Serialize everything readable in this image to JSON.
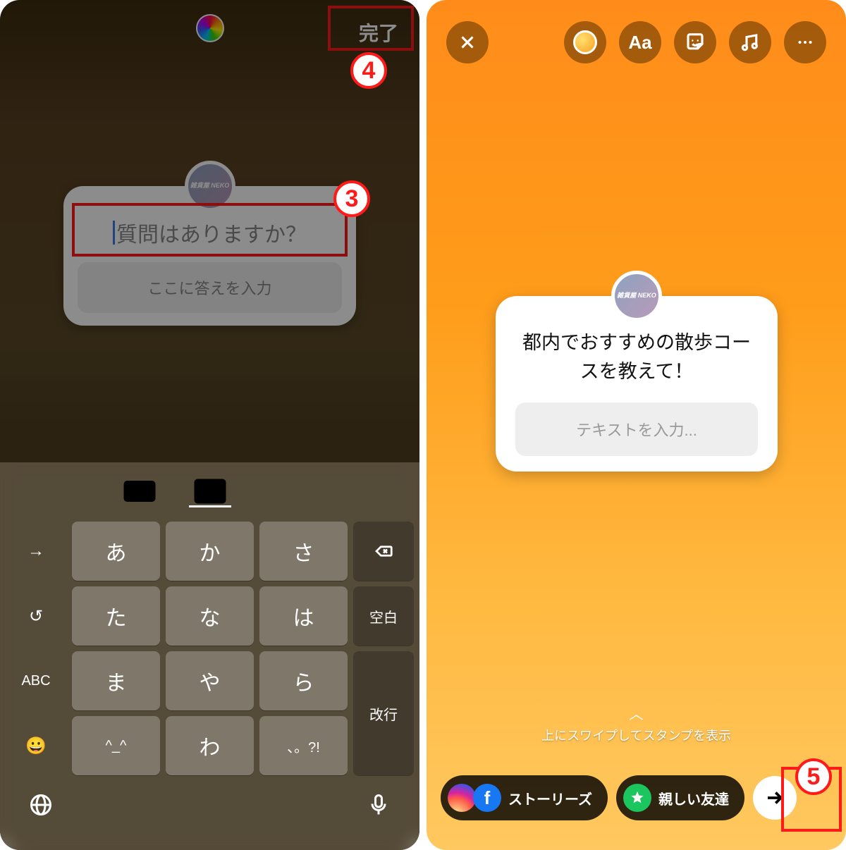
{
  "annotations": {
    "marker3": "3",
    "marker4": "4",
    "marker5": "5"
  },
  "left": {
    "done_label": "完了",
    "avatar_text": "雑貨屋\nNEKO",
    "question_placeholder": "質問はありますか？",
    "answer_placeholder": "ここに答えを入力",
    "keyboard": {
      "row1": [
        "あ",
        "か",
        "さ"
      ],
      "row2": [
        "た",
        "な",
        "は"
      ],
      "row3": [
        "ま",
        "や",
        "ら"
      ],
      "row4": [
        "^_^",
        "わ",
        "、。?!"
      ],
      "side": {
        "arrow": "→",
        "undo": "↺",
        "abc": "ABC",
        "emoji": "😀",
        "space": "空白",
        "return": "改行"
      }
    }
  },
  "right": {
    "text_tool": "Aa",
    "avatar_text": "雑貨屋\nNEKO",
    "question_text": "都内でおすすめの散歩コースを教えて！",
    "answer_placeholder": "テキストを入力...",
    "swipe_hint": "上にスワイプしてスタンプを表示",
    "share": {
      "stories": "ストーリーズ",
      "close_friends": "親しい友達",
      "fb_letter": "f"
    }
  }
}
